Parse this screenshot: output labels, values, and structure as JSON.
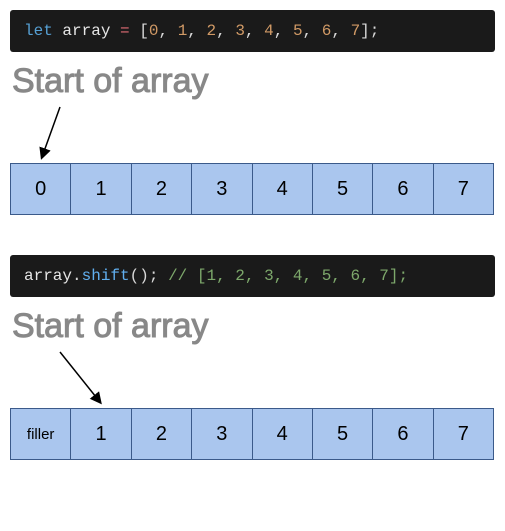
{
  "code1": {
    "kw": "let",
    "var": "array",
    "op": "=",
    "open": "[",
    "nums": [
      "0",
      "1",
      "2",
      "3",
      "4",
      "5",
      "6",
      "7"
    ],
    "close": "];"
  },
  "label1": "Start of array",
  "cells1": [
    "0",
    "1",
    "2",
    "3",
    "4",
    "5",
    "6",
    "7"
  ],
  "code2": {
    "var": "array",
    "dot": ".",
    "meth": "shift",
    "parens": "()",
    "semi": ";",
    "comment": "// [1, 2, 3, 4, 5, 6, 7];"
  },
  "label2": "Start of array",
  "cells2": [
    "filler",
    "1",
    "2",
    "3",
    "4",
    "5",
    "6",
    "7"
  ]
}
